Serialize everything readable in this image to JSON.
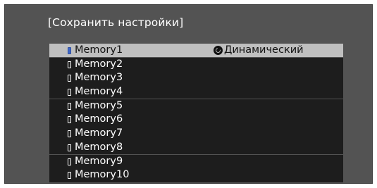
{
  "title": "[Сохранить настройки]",
  "memory_list": {
    "items": [
      {
        "label": "Memory1",
        "mode": "Динамический",
        "selected": true,
        "mode_icon": "color-mode-icon"
      },
      {
        "label": "Memory2",
        "mode": "",
        "selected": false
      },
      {
        "label": "Memory3",
        "mode": "",
        "selected": false
      },
      {
        "label": "Memory4",
        "mode": "",
        "selected": false
      },
      {
        "label": "Memory5",
        "mode": "",
        "selected": false
      },
      {
        "label": "Memory6",
        "mode": "",
        "selected": false
      },
      {
        "label": "Memory7",
        "mode": "",
        "selected": false
      },
      {
        "label": "Memory8",
        "mode": "",
        "selected": false
      },
      {
        "label": "Memory9",
        "mode": "",
        "selected": false
      },
      {
        "label": "Memory10",
        "mode": "",
        "selected": false
      }
    ],
    "item_icon": "memory-slot-icon"
  },
  "colors": {
    "panel_background": "#535353",
    "row_background": "#1d1d1d",
    "selected_row_background": "#bfbfbf",
    "selected_icon_color": "#3f68c8"
  }
}
